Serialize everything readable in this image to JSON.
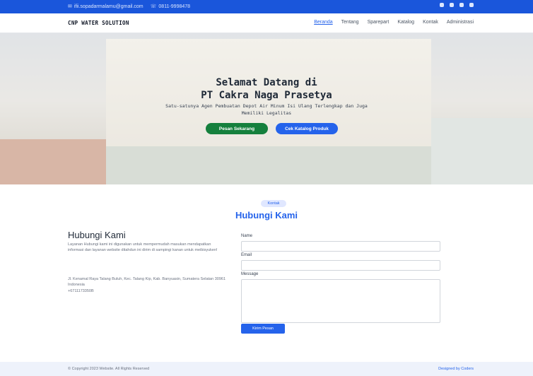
{
  "topbar": {
    "email": "ifii.sopadarmalamu@gmail.com",
    "phone": "0811-9998478",
    "social_icons": [
      "twitter-icon",
      "facebook-icon",
      "instagram-icon",
      "linkedin-icon"
    ]
  },
  "navbar": {
    "brand": "CNP WATER SOLUTION",
    "items": [
      "Beranda",
      "Tentang",
      "Sparepart",
      "Katalog",
      "Kontak",
      "Administrasi"
    ],
    "active_index": 0
  },
  "hero": {
    "title_line1": "Selamat Datang di",
    "title_line2": "PT Cakra Naga Prasetya",
    "subtitle_line1": "Satu-satunya Agen Pembuatan Depot Air Minum Isi Ulang Terlengkap dan Juga",
    "subtitle_line2": "Memiliki Legalitas",
    "btn_primary": "Pesan Sekarang",
    "btn_secondary": "Cek Katalog Produk"
  },
  "contact_section": {
    "badge": "Kontak",
    "title": "Hubungi Kami",
    "left_title": "Hubungi Kami",
    "description": "Layanan Hubungi kami ini digunakan untuk mempermudah masukan mendapatkan informasi dan layanan website ditahdun ini dirim di sampingi kanan untuk meibisyuken!",
    "address": "Jl. Kenamal Raya Talang Buluh, Kec. Talang Kip, Kab. Banyuasin, Sumatera Selatan 30961 Indonesia",
    "phone": "+6711173350B"
  },
  "form": {
    "name_label": "Name",
    "email_label": "Email",
    "message_label": "Message",
    "submit_label": "Kirim Pesan"
  },
  "footer": {
    "copyright": "© Copyright 2023 Website. All Rights Reserved",
    "credit": "Designed by Coders"
  },
  "colors": {
    "primary": "#2563eb",
    "topbar": "#1a56db",
    "green": "#15803d"
  }
}
